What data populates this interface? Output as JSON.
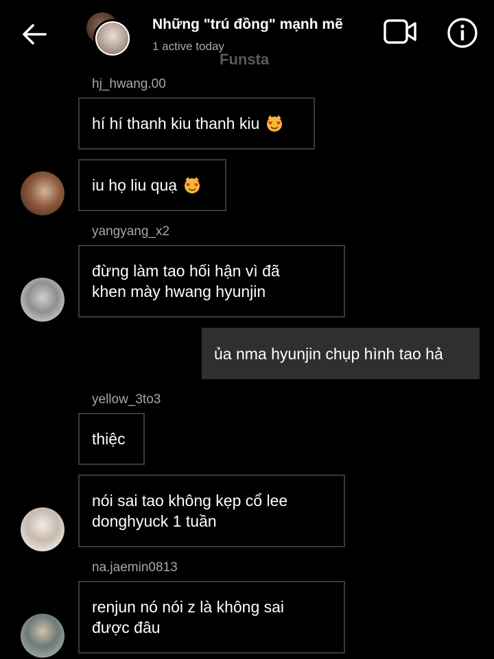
{
  "header": {
    "title": "Những \"trú đồng\" mạnh mẽ",
    "status": "1 active today",
    "watermark": "Funsta",
    "back_icon": "arrow-left-icon",
    "video_icon": "video-camera-icon",
    "info_icon": "info-circle-icon"
  },
  "messages": [
    {
      "sender": "hj_hwang.00",
      "text": "hí hí thanh kiu thanh kiu",
      "emoji": "heart-eyes-cat-emoji"
    },
    {
      "text": "iu họ liu quạ",
      "emoji": "heart-eyes-cat-emoji"
    },
    {
      "sender": "yangyang_x2",
      "text": "đừng làm tao hối hận vì đã\nkhen mày hwang hyunjin"
    },
    {
      "text": "ủa nma hyunjin chụp hình tao hả",
      "mine": true
    },
    {
      "sender": "yellow_3to3",
      "text": "thiệc"
    },
    {
      "text": "nói sai tao không kẹp cổ lee\ndonghyuck 1 tuần"
    },
    {
      "sender": "na.jaemin0813",
      "text": "renjun nó nói z là không sai\nđược đâu"
    }
  ],
  "colors": {
    "background": "#000000",
    "bubble_border": "#3a3a3a",
    "my_bubble": "#2f2f2f",
    "secondary_text": "#a8a8a8"
  }
}
